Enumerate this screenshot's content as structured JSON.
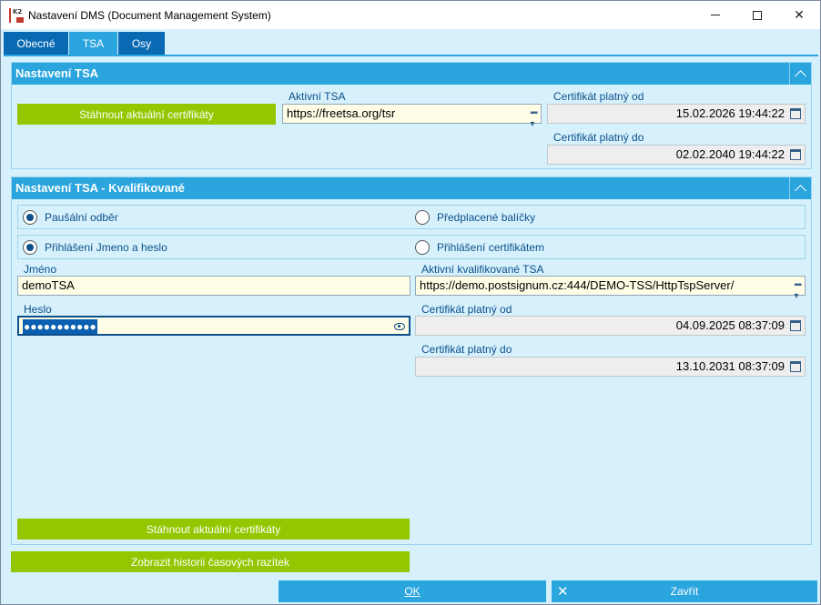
{
  "window": {
    "title": "Nastavení DMS (Document Management System)"
  },
  "titlebar_buttons": {
    "minimize": "—",
    "maximize": "☐",
    "close": "✕"
  },
  "tabs": [
    {
      "label": "Obecné",
      "active": false
    },
    {
      "label": "TSA",
      "active": true
    },
    {
      "label": "Osy",
      "active": false
    }
  ],
  "tsa": {
    "header": "Nastavení TSA",
    "download_button": "Stáhnout aktuální certifikáty",
    "active_tsa_label": "Aktivní TSA",
    "active_tsa_value": "https://freetsa.org/tsr",
    "cert_from_label": "Certifikát platný od",
    "cert_from_value": "15.02.2026 19:44:22",
    "cert_to_label": "Certifikát platný do",
    "cert_to_value": "02.02.2040 19:44:22"
  },
  "qualified": {
    "header": "Nastavení TSA - Kvalifikované",
    "radio_flat": "Paušální odběr",
    "radio_prepaid": "Předplacené balíčky",
    "radio_login_name": "Přihlášení Jmeno a heslo",
    "radio_login_cert": "Přihlášení certifikátem",
    "name_label": "Jméno",
    "name_value": "demoTSA",
    "password_label": "Heslo",
    "password_value": "●●●●●●●●●●●",
    "active_qual_label": "Aktivní kvalifikované TSA",
    "active_qual_value": "https://demo.postsignum.cz:444/DEMO-TSS/HttpTspServer/",
    "cert_from_label": "Certifikát platný od",
    "cert_from_value": "04.09.2025 08:37:09",
    "cert_to_label": "Certifikát platný do",
    "cert_to_value": "13.10.2031 08:37:09",
    "download_button": "Stáhnout aktuální certifikáty"
  },
  "history_button": "Zobrazit historii časových razítek",
  "footer": {
    "ok": "OK",
    "close": "Zavřít"
  },
  "colors": {
    "accent": "#2aa5de",
    "tab_dark": "#0a69b3",
    "green": "#94c700",
    "background": "#d6f1fc"
  }
}
